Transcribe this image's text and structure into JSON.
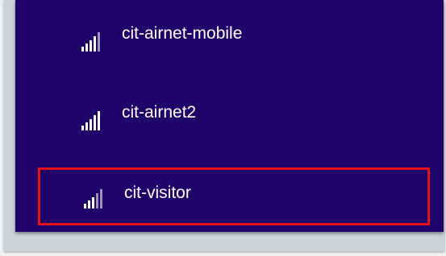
{
  "networks": [
    {
      "name": "cit-airnet-mobile",
      "signal_bars": 5,
      "selected": false
    },
    {
      "name": "cit-airnet2",
      "signal_bars": 5,
      "selected": false
    },
    {
      "name": "cit-visitor",
      "signal_bars": 5,
      "selected": true
    }
  ],
  "colors": {
    "panel_background": "#20036a",
    "selection_border": "#e8101a",
    "text": "#ffffff"
  },
  "icons": {
    "signal": "wifi-signal-icon"
  }
}
